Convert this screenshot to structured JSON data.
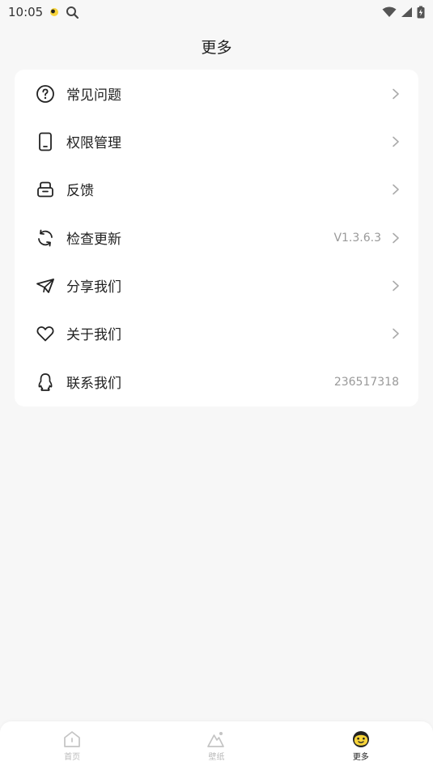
{
  "status_bar": {
    "time": "10:05"
  },
  "header": {
    "title": "更多"
  },
  "menu": {
    "items": [
      {
        "label": "常见问题",
        "icon": "question-circle-icon",
        "value": "",
        "chevron": true
      },
      {
        "label": "权限管理",
        "icon": "phone-device-icon",
        "value": "",
        "chevron": true
      },
      {
        "label": "反馈",
        "icon": "feedback-inbox-icon",
        "value": "",
        "chevron": true
      },
      {
        "label": "检查更新",
        "icon": "refresh-icon",
        "value": "V1.3.6.3",
        "chevron": true
      },
      {
        "label": "分享我们",
        "icon": "paper-plane-icon",
        "value": "",
        "chevron": true
      },
      {
        "label": "关于我们",
        "icon": "heart-icon",
        "value": "",
        "chevron": true
      },
      {
        "label": "联系我们",
        "icon": "qq-penguin-icon",
        "value": "236517318",
        "chevron": false
      }
    ]
  },
  "bottom_nav": {
    "items": [
      {
        "label": "首页",
        "icon": "home-icon",
        "active": false
      },
      {
        "label": "壁纸",
        "icon": "wallpaper-mountain-icon",
        "active": false
      },
      {
        "label": "更多",
        "icon": "smiley-face-icon",
        "active": true
      }
    ]
  },
  "colors": {
    "background": "#f7f7f7",
    "card": "#ffffff",
    "accent_yellow": "#f7d43a",
    "inactive_nav": "#bbbbbb"
  }
}
